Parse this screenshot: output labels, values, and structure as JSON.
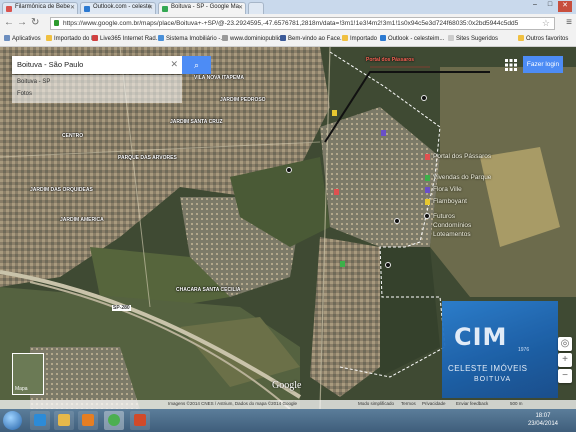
{
  "browser": {
    "tabs": [
      {
        "label": "Filarmônica de Bebe",
        "fav_color": "#d9534f",
        "active": false
      },
      {
        "label": "Outlook.com - celeste",
        "fav_color": "#2b79d1",
        "active": false
      },
      {
        "label": "Boituva - SP - Google Ma",
        "fav_color": "#34a853",
        "active": true
      }
    ],
    "url": "https://www.google.com.br/maps/place/Boituva+-+SP/@-23.2924595,-47.6576781,2818m/data=!3m1!1e3!4m2!3m1!1s0x94c5e3d724f68035:0x2bd5944c5dd5",
    "bookmarks": [
      {
        "label": "Aplicativos",
        "color": "#6c8ebf"
      },
      {
        "label": "Importado do IE",
        "color": "#f0c040"
      },
      {
        "label": "Live365 Internet Rad...",
        "color": "#d04040"
      },
      {
        "label": "Sistema Imobiliário -...",
        "color": "#4a90d9"
      },
      {
        "label": "www.dominiopublic...",
        "color": "#999999"
      },
      {
        "label": "Bem-vindo ao Face...",
        "color": "#3b5998"
      },
      {
        "label": "Importado",
        "color": "#f0c040"
      },
      {
        "label": "Outlook - celesteim...",
        "color": "#2b79d1"
      },
      {
        "label": "Sites Sugeridos",
        "color": "#cccccc"
      },
      {
        "label": "Outros favoritos",
        "color": "#f0c040"
      }
    ]
  },
  "maps": {
    "search_value": "Boituva - São Paulo",
    "suggestions": [
      "Boituva - SP",
      "Fotos"
    ],
    "signin_label": "Fazer login",
    "thumbnail_label": "Mapa",
    "google_logo": "Google",
    "footer": [
      "Imagens ©2014 CNES / Astrium, Dados do mapa ©2014 Google",
      "Modo simplificado",
      "Termos",
      "Privacidade",
      "Enviar feedback",
      "500 m"
    ]
  },
  "legend": [
    {
      "label": "Portal dos Pássaros",
      "color": "#e05050"
    },
    {
      "label": "Vivendas do Parque",
      "color": "#3cb04a"
    },
    {
      "label": "Flora Ville",
      "color": "#6a4fc8"
    },
    {
      "label": "Flamboyant",
      "color": "#e8c830"
    },
    {
      "label": "Futuros",
      "color": "#111111"
    },
    {
      "label": "Condomínios",
      "color": null
    },
    {
      "label": "Loteamentos",
      "color": null
    }
  ],
  "map_labels": [
    "VILA NOVA ITAPEMA",
    "JARDIM PEDROSO",
    "JARDIM SANTA CRUZ",
    "CENTRO",
    "JARDIM AMERICA",
    "PARQUE DAS ARVORES",
    "JARDIM DAS ORQUIDEAS",
    "CHACARA SANTA CECILIA",
    "Portal dos Pássaros",
    "SP-280"
  ],
  "logo": {
    "mark": "CIM",
    "year": "1976",
    "name": "CELESTE IMÓVEIS",
    "city": "BOITUVA"
  },
  "taskbar": {
    "apps": [
      {
        "name": "ie-icon",
        "color": "#2c8bd8"
      },
      {
        "name": "explorer-icon",
        "color": "#e6b84a"
      },
      {
        "name": "media-icon",
        "color": "#e67e22"
      },
      {
        "name": "chrome-icon",
        "color": "#4caf50"
      },
      {
        "name": "office-icon",
        "color": "#d04a2a"
      }
    ],
    "time": "18:07",
    "date": "23/04/2014"
  }
}
